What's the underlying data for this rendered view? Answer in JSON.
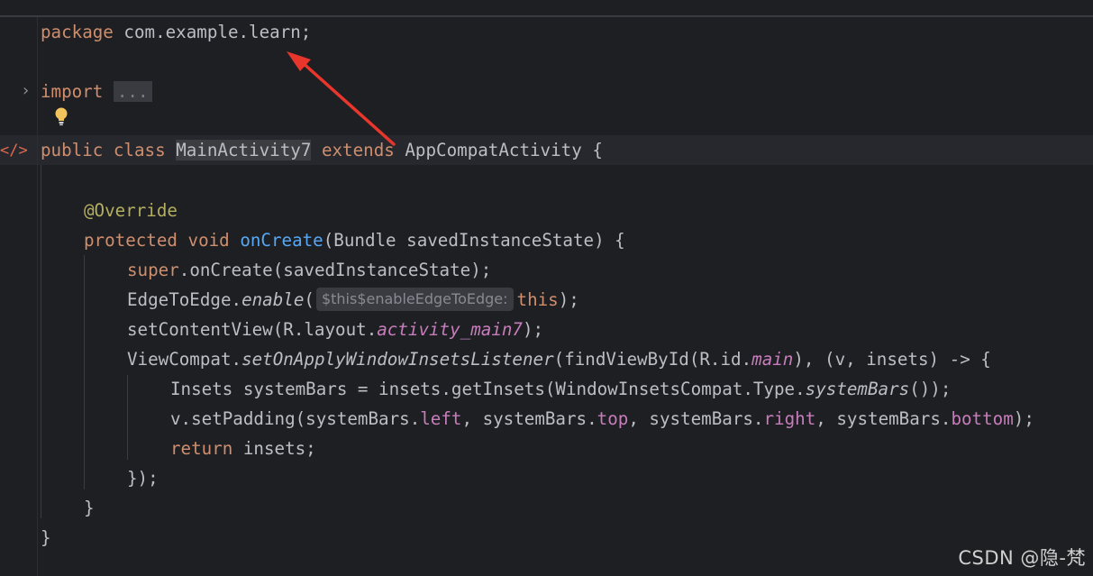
{
  "editor": {
    "lines": {
      "l1": {
        "kw": "package",
        "text": " com.example.learn;"
      },
      "l2": {
        "kw": "import",
        "fold": "..."
      },
      "l3": {
        "kw1": "public",
        "kw2": "class",
        "cls": "MainActivity7",
        "kw3": "extends",
        "text": " AppCompatActivity {"
      },
      "l4": {
        "ann": "@Override"
      },
      "l5": {
        "kw1": "protected",
        "kw2": "void",
        "fn": "onCreate",
        "text": "(Bundle savedInstanceState) {"
      },
      "l6": {
        "kw": "super",
        "text": ".onCreate(savedInstanceState);"
      },
      "l7": {
        "a": "EdgeToEdge.",
        "b": "enable",
        "c": "(",
        "hint": "$this$enableEdgeToEdge:",
        "kw": "this",
        "d": ");"
      },
      "l8": {
        "a": "setContentView(R.layout.",
        "b": "activity_main7",
        "c": ");"
      },
      "l9": {
        "a": "ViewCompat.",
        "b": "setOnApplyWindowInsetsListener",
        "c": "(findViewById(R.id.",
        "d": "main",
        "e": "), (v, insets) -> {"
      },
      "l10": {
        "a": "Insets systemBars = insets.getInsets(WindowInsetsCompat.Type.",
        "b": "systemBars",
        "c": "());"
      },
      "l11": {
        "a": "v.setPadding(systemBars.",
        "f1": "left",
        "b": ", systemBars.",
        "f2": "top",
        "c": ", systemBars.",
        "f3": "right",
        "d": ", systemBars.",
        "f4": "bottom",
        "e": ");"
      },
      "l12": {
        "kw": "return",
        "text": " insets;"
      },
      "l13": {
        "text": "});"
      },
      "l14": {
        "text": "}"
      },
      "l15": {
        "text": "}"
      }
    },
    "gutter": {
      "fold_icon": "chevron-right-icon",
      "intention_icon": "lightbulb-icon",
      "code_marker": "</>"
    },
    "colors": {
      "background": "#1e1f22",
      "keyword": "#cf8e6d",
      "annotation": "#b3ae60",
      "method": "#56a8f5",
      "field": "#c77dbb",
      "text": "#bcbec4",
      "arrow": "#e8362c"
    }
  },
  "watermark": "CSDN @隐-梵"
}
